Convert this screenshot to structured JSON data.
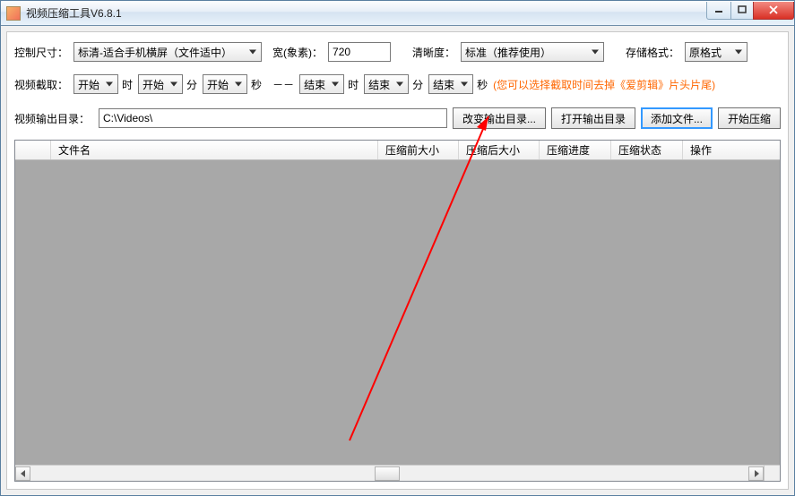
{
  "window": {
    "title": "视频压缩工具V6.8.1"
  },
  "row1": {
    "size_label": "控制尺寸：",
    "size_value": "标清-适合手机横屏（文件适中）",
    "width_label": "宽(象素)：",
    "width_value": "720",
    "clarity_label": "清晰度：",
    "clarity_value": "标准（推荐使用）",
    "format_label": "存储格式：",
    "format_value": "原格式"
  },
  "row2": {
    "trim_label": "视频截取：",
    "start": "开始",
    "end": "结束",
    "hour": "时",
    "min": "分",
    "sec": "秒",
    "dash": "－－",
    "tip": "(您可以选择截取时间去掉《爱剪辑》片头片尾)"
  },
  "row3": {
    "outdir_label": "视频输出目录：",
    "outdir_value": "C:\\Videos\\",
    "change_btn": "改变输出目录...",
    "open_btn": "打开输出目录",
    "add_btn": "添加文件...",
    "start_btn": "开始压缩"
  },
  "grid": {
    "cols": [
      "",
      "文件名",
      "压缩前大小",
      "压缩后大小",
      "压缩进度",
      "压缩状态",
      "操作"
    ]
  }
}
